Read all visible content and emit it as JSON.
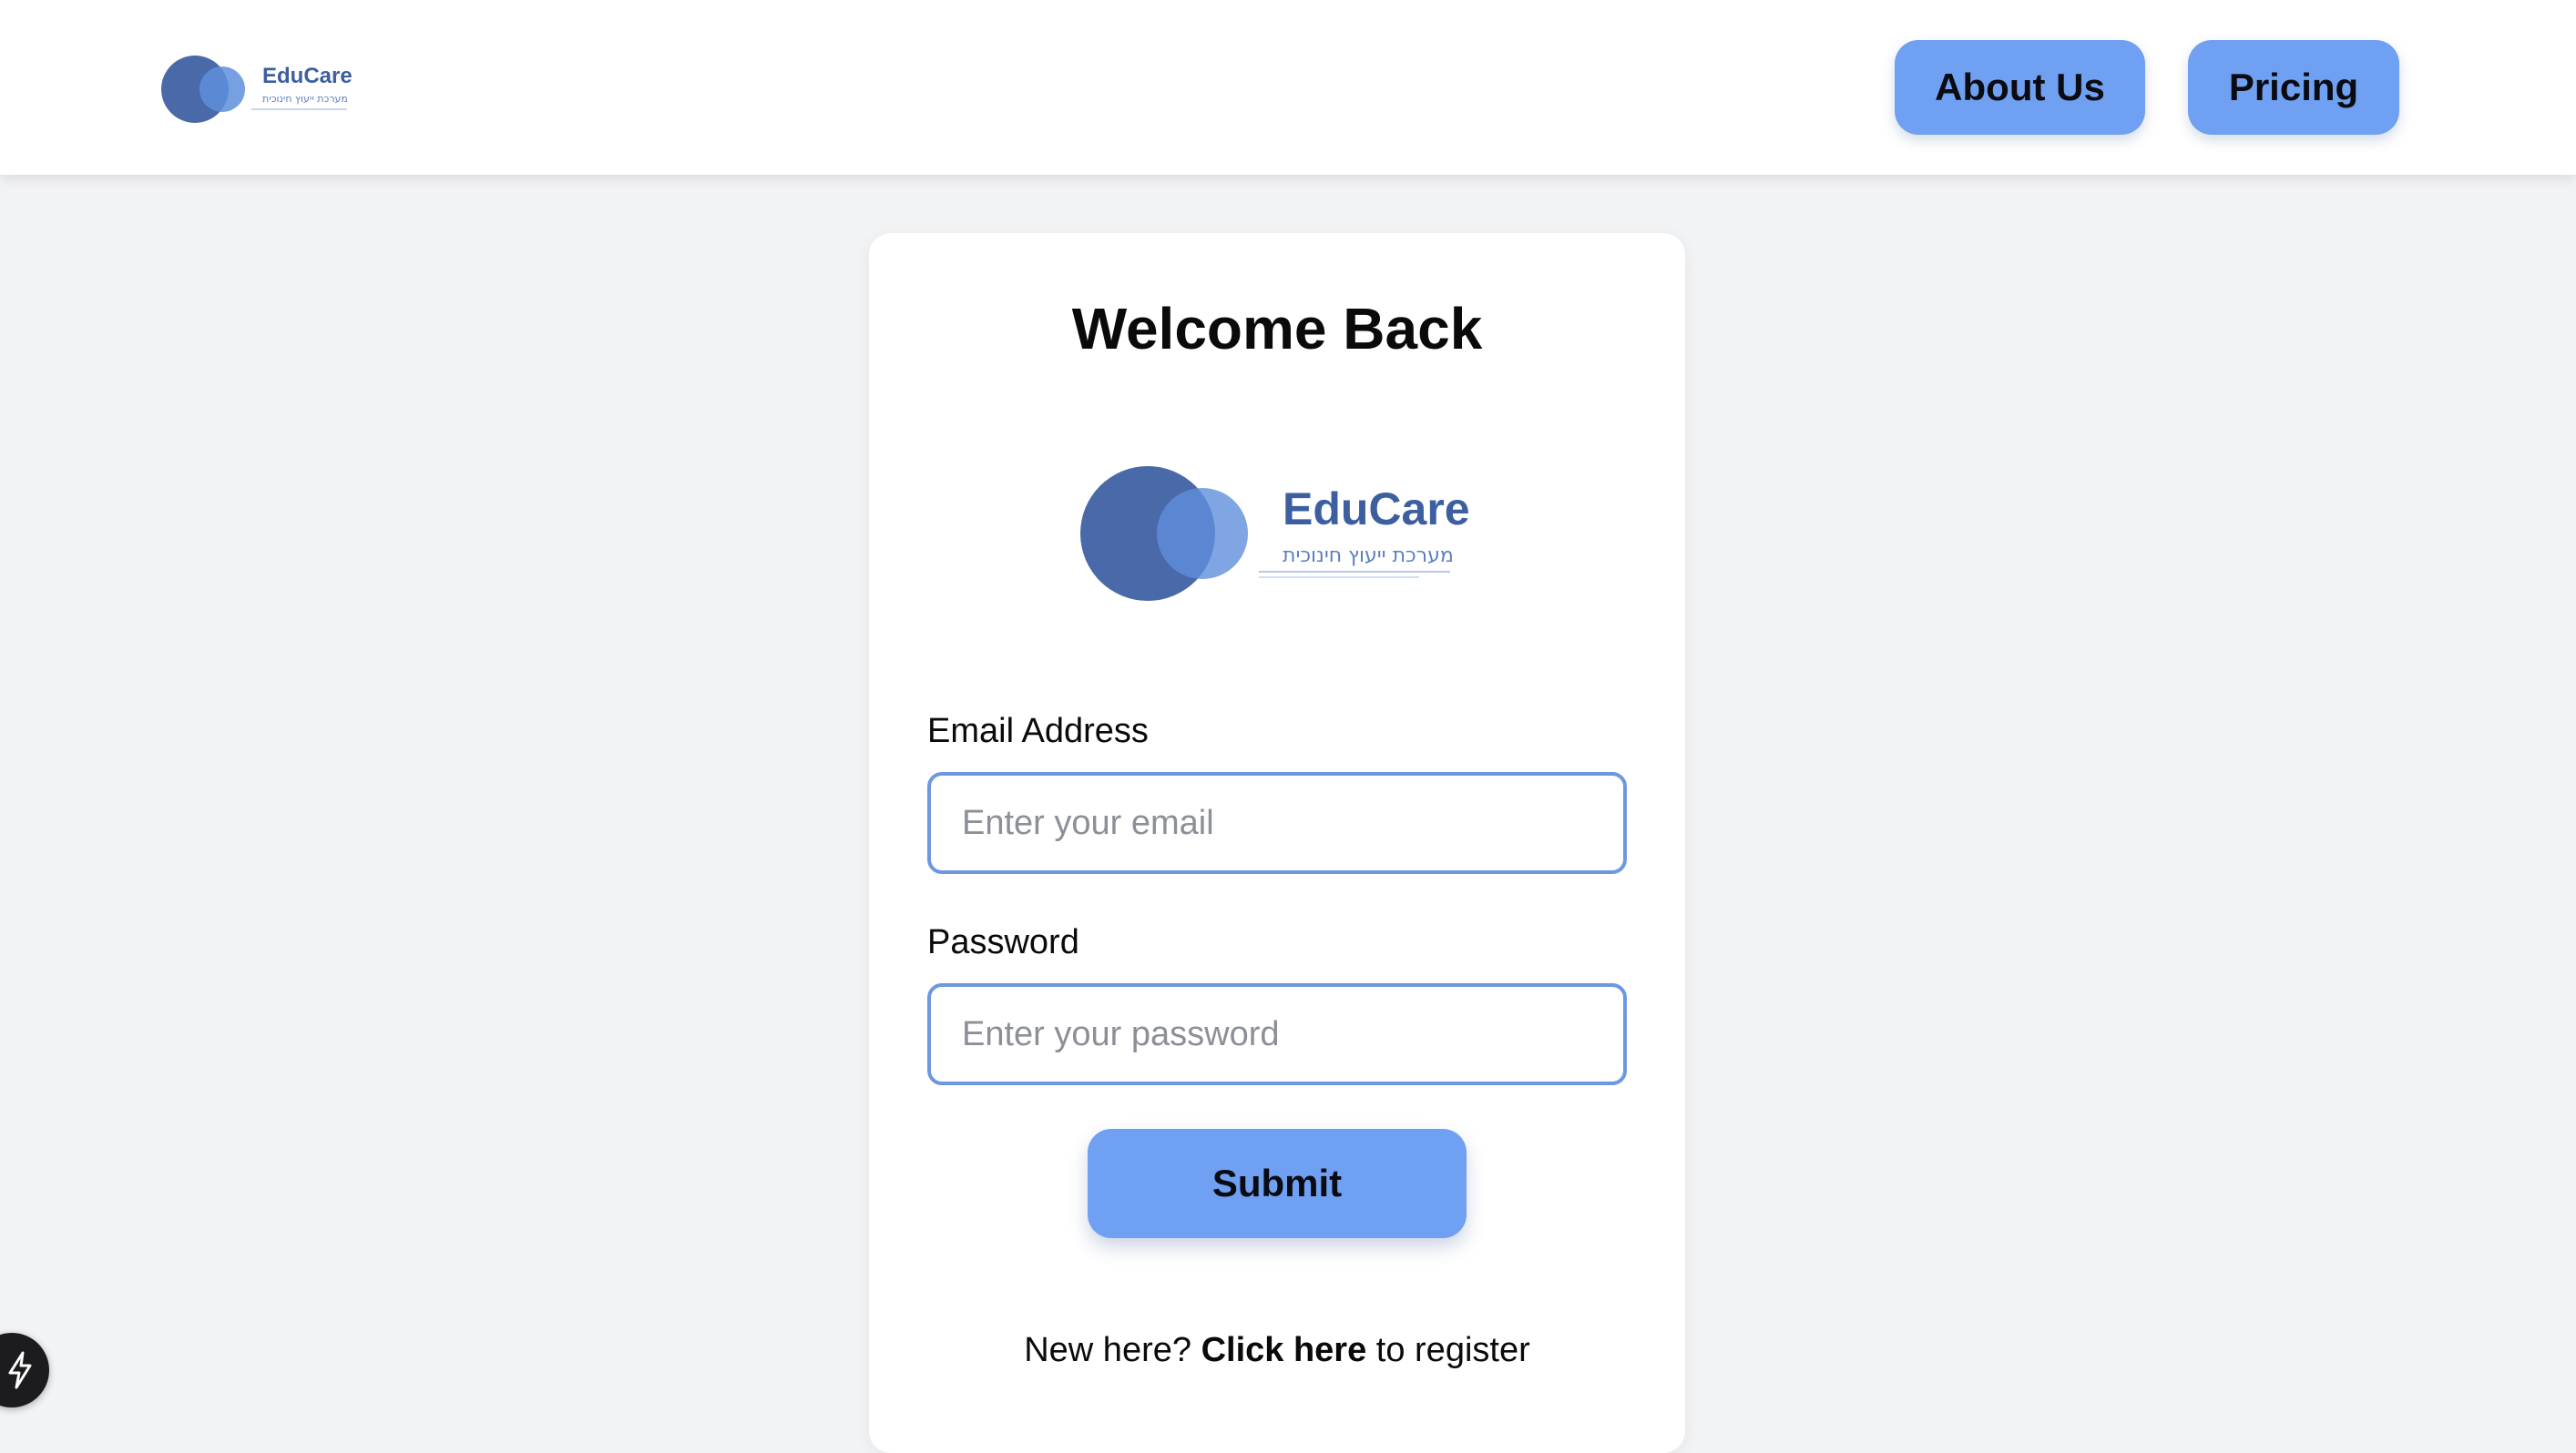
{
  "brand": {
    "name": "EduCare",
    "tagline": "מערכת ייעוץ חינוכית"
  },
  "header": {
    "nav": {
      "about_label": "About Us",
      "pricing_label": "Pricing"
    }
  },
  "login": {
    "title": "Welcome Back",
    "email": {
      "label": "Email Address",
      "placeholder": "Enter your email",
      "value": ""
    },
    "password": {
      "label": "Password",
      "placeholder": "Enter your password",
      "value": ""
    },
    "submit_label": "Submit",
    "register": {
      "prefix": "New here? ",
      "link_label": "Click here",
      "suffix": " to register"
    }
  },
  "dev_badge": {
    "icon": "lightning-icon"
  },
  "colors": {
    "accent": "#6fa0f2",
    "input_border": "#6c98e2",
    "logo_dark": "#4a69a8",
    "logo_light": "#5f8fdc",
    "brand_text": "#3d5fa0",
    "background": "#f2f3f5"
  }
}
